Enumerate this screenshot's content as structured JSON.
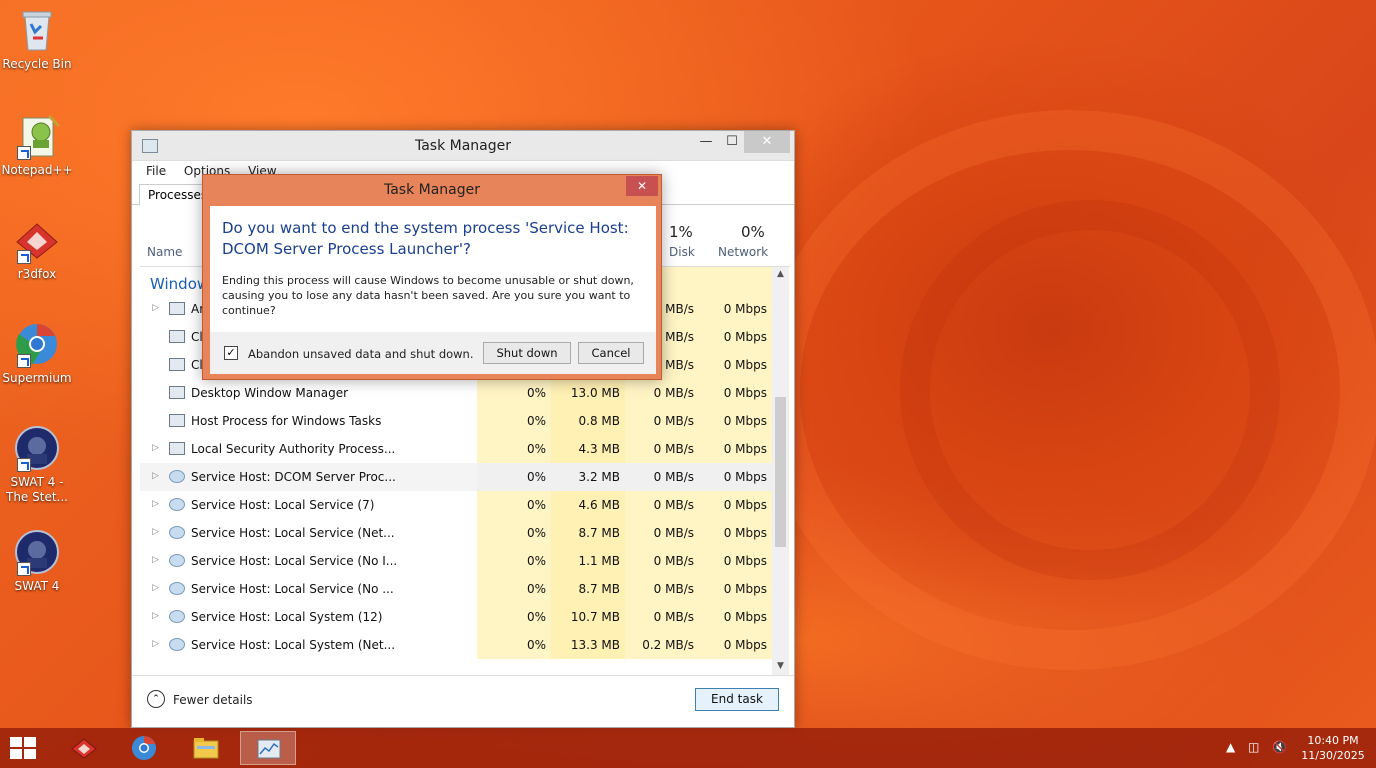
{
  "desktop": {
    "icons": [
      {
        "label": "Recycle Bin"
      },
      {
        "label": "Notepad++"
      },
      {
        "label": "r3dfox"
      },
      {
        "label": "Supermium"
      },
      {
        "label": "SWAT 4 - The Stet..."
      },
      {
        "label": "SWAT 4"
      }
    ]
  },
  "task_manager": {
    "title": "Task Manager",
    "menu": [
      "File",
      "Options",
      "View"
    ],
    "tab": "Processes",
    "columns": {
      "name": "Name",
      "disk_pct": "1%",
      "disk": "Disk",
      "network_pct": "0%",
      "network": "Network"
    },
    "group_title": "Window",
    "rows": [
      {
        "name": "Ar",
        "cpu": "",
        "memory": "",
        "disk": "MB/s",
        "network": "0 Mbps",
        "expander": true,
        "selected": false
      },
      {
        "name": "Cl",
        "cpu": "",
        "memory": "",
        "disk": "MB/s",
        "network": "0 Mbps",
        "expander": false,
        "selected": false
      },
      {
        "name": "Cl",
        "cpu": "",
        "memory": "",
        "disk": "MB/s",
        "network": "0 Mbps",
        "expander": false,
        "selected": false
      },
      {
        "name": "Desktop Window Manager",
        "cpu": "0%",
        "memory": "13.0 MB",
        "disk": "0 MB/s",
        "network": "0 Mbps",
        "expander": false,
        "selected": false
      },
      {
        "name": "Host Process for Windows Tasks",
        "cpu": "0%",
        "memory": "0.8 MB",
        "disk": "0 MB/s",
        "network": "0 Mbps",
        "expander": false,
        "selected": false
      },
      {
        "name": "Local Security Authority Process...",
        "cpu": "0%",
        "memory": "4.3 MB",
        "disk": "0 MB/s",
        "network": "0 Mbps",
        "expander": true,
        "selected": false
      },
      {
        "name": "Service Host: DCOM Server Proc...",
        "cpu": "0%",
        "memory": "3.2 MB",
        "disk": "0 MB/s",
        "network": "0 Mbps",
        "expander": true,
        "selected": true
      },
      {
        "name": "Service Host: Local Service (7)",
        "cpu": "0%",
        "memory": "4.6 MB",
        "disk": "0 MB/s",
        "network": "0 Mbps",
        "expander": true,
        "selected": false
      },
      {
        "name": "Service Host: Local Service (Net...",
        "cpu": "0%",
        "memory": "8.7 MB",
        "disk": "0 MB/s",
        "network": "0 Mbps",
        "expander": true,
        "selected": false
      },
      {
        "name": "Service Host: Local Service (No I...",
        "cpu": "0%",
        "memory": "1.1 MB",
        "disk": "0 MB/s",
        "network": "0 Mbps",
        "expander": true,
        "selected": false
      },
      {
        "name": "Service Host: Local Service (No ...",
        "cpu": "0%",
        "memory": "8.7 MB",
        "disk": "0 MB/s",
        "network": "0 Mbps",
        "expander": true,
        "selected": false
      },
      {
        "name": "Service Host: Local System (12)",
        "cpu": "0%",
        "memory": "10.7 MB",
        "disk": "0 MB/s",
        "network": "0 Mbps",
        "expander": true,
        "selected": false
      },
      {
        "name": "Service Host: Local System (Net...",
        "cpu": "0%",
        "memory": "13.3 MB",
        "disk": "0.2 MB/s",
        "network": "0 Mbps",
        "expander": true,
        "selected": false
      }
    ],
    "fewer_details": "Fewer details",
    "end_task": "End task"
  },
  "dialog": {
    "title": "Task Manager",
    "headline": "Do you want to end the system process 'Service Host: DCOM Server Process Launcher'?",
    "description": "Ending this process will cause Windows to become unusable or shut down, causing you to lose any data hasn't been saved. Are you sure you want to continue?",
    "checkbox_label": "Abandon unsaved data and shut down.",
    "checkbox_checked": true,
    "shutdown_label": "Shut down",
    "cancel_label": "Cancel"
  },
  "taskbar": {
    "time": "10:40 PM",
    "date": "11/30/2025"
  }
}
